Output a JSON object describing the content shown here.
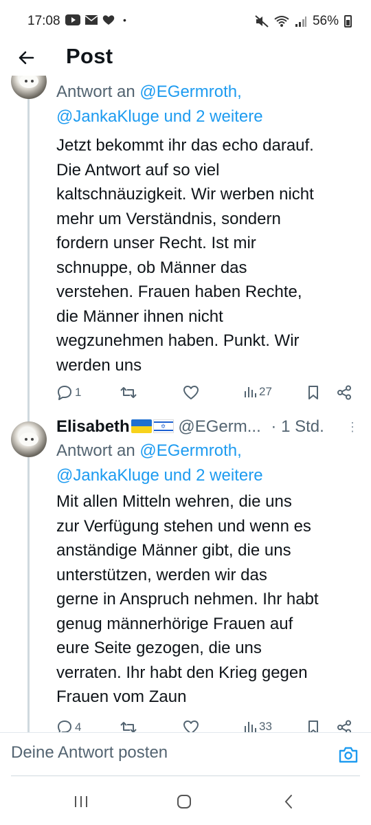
{
  "status_bar": {
    "time": "17:08",
    "battery": "56%"
  },
  "header": {
    "title": "Post"
  },
  "tweets": [
    {
      "reply_prefix": "Antwort an ",
      "reply_mentions": "@EGermroth,",
      "reply_mentions_2": "@JankaKluge und 2 weitere",
      "text": "Jetzt bekommt ihr das echo darauf.\nDie Antwort auf so viel\nkaltschnäuzigkeit. Wir werben nicht\nmehr um Verständnis,  sondern\nfordern unser Recht.  Ist mir\nschnuppe, ob Männer das\nverstehen.  Frauen haben Rechte,\ndie Männer ihnen nicht\nwegzunehmen haben.  Punkt.  Wir\nwerden uns",
      "replies": "1",
      "views": "27"
    },
    {
      "name": "Elisabeth",
      "handle": "@EGerm...",
      "time": "· 1 Std.",
      "reply_prefix": "Antwort an ",
      "reply_mentions": "@EGermroth,",
      "reply_mentions_2": "@JankaKluge und 2 weitere",
      "text": "Mit allen Mitteln wehren, die uns\nzur Verfügung stehen und wenn es\nanständige Männer gibt, die uns\nunterstützen,  werden wir das\ngerne in Anspruch nehmen. Ihr habt\ngenug männerhörige Frauen auf\neure Seite gezogen,  die uns\nverraten.  Ihr habt den Krieg gegen\nFrauen vom Zaun",
      "replies": "4",
      "views": "33"
    }
  ],
  "composer": {
    "placeholder": "Deine Antwort posten"
  },
  "icons": {
    "back": "arrow-left-icon",
    "reply": "comment-icon",
    "retweet": "retweet-icon",
    "like": "heart-icon",
    "views": "bar-chart-icon",
    "bookmark": "bookmark-icon",
    "share": "share-icon",
    "camera": "camera-icon"
  },
  "colors": {
    "accent": "#1d9bf0",
    "secondary_text": "#536471",
    "thread_line": "#cfd9de"
  }
}
